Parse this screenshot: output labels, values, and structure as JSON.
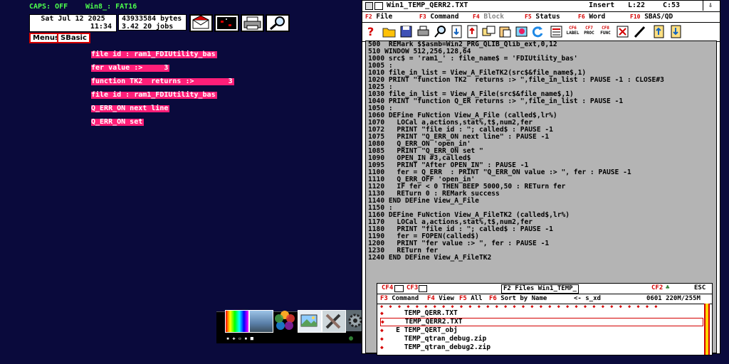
{
  "status": {
    "caps": "CAPS: OFF",
    "win": "Win8_: FAT16",
    "date": "Sat Jul 12 2025",
    "time": "11:34",
    "bytes": "43933584 bytes",
    "jobs": "3.42   20 jobs"
  },
  "buttons": {
    "menus": "Menus",
    "sbasic": "SBasic"
  },
  "output_lines": [
    "file id : ram1_FDIUtility_bas",
    "fer value :>     3",
    "function TK2  returns :>        3",
    "file id : ram1_FDIUtility_bas",
    "Q_ERR_ON next line",
    "Q_ERR_ON set"
  ],
  "editor": {
    "title": "Win1_TEMP_QERR2.TXT",
    "mode": "Insert",
    "line": "L:22",
    "col": "C:53",
    "menu": [
      {
        "key": "F2",
        "label": "File"
      },
      {
        "key": "F3",
        "label": "Command"
      },
      {
        "key": "F4",
        "label": "Block"
      },
      {
        "key": "F5",
        "label": "Status"
      },
      {
        "key": "F6",
        "label": "Word"
      },
      {
        "key": "F10",
        "label": "SBAS/QD"
      }
    ],
    "code": [
      "500  REMark $$asmb=Win2_PRG_QLIB_Qlib_ext,0,12",
      "510 WINDOW 512,256,128,64",
      "1000 src$ = 'ram1_' : file_name$ = 'FDIUtility_bas'",
      "1005 :",
      "1010 file_in_list = View_A_FileTK2(src$&file_name$,1)",
      "1020 PRINT \"function TK2  returns :> \",file_in_list : PAUSE -1 : CLOSE#3",
      "1025 :",
      "1030 file_in_list = View_A_File(src$&file_name$,1)",
      "1040 PRINT \"function Q_ER returns :> \",file_in_list : PAUSE -1",
      "1050 :",
      "1060 DEFine FuNction View_A_File (called$,lr%)",
      "1070   LOCal a,actions,stat%,t$,num2,fer",
      "1072   PRINT \"file id : \"; called$ : PAUSE -1",
      "1075   PRINT \"Q_ERR_ON next line\" : PAUSE -1",
      "1080   Q_ERR_ON 'open_in'",
      "1085   PRINT \"Q_ERR_ON set \"",
      "1090   OPEN_IN #3,called$",
      "1095   PRINT \"After OPEN_IN\" : PAUSE -1",
      "1100   fer = Q_ERR  : PRINT \"Q_ERR_ON value :> \", fer : PAUSE -1",
      "1110   Q_ERR_OFF 'open_in'",
      "1120   IF fer < 0 THEN BEEP 5000,50 : RETurn fer",
      "1130   RETurn 0 : REMark success",
      "1140 END DEFine View_A_File",
      "1150 :",
      "1160 DEFine FuNction View_A_FileTK2 (called$,lr%)",
      "1170   LOCal a,actions,stat%,t$,num2,fer",
      "1180   PRINT \"file id : \"; called$ : PAUSE -1",
      "1190   fer = FOPEN(called$)",
      "1200   PRINT \"fer value :> \", fer : PAUSE -1",
      "1230   RETurn fer",
      "1240 END DEFine View_A_FileTK2"
    ]
  },
  "files": {
    "title": "F2 Files Win1_TEMP_",
    "esc": "ESC",
    "count": "0601  220M/255M",
    "menu": {
      "command": "Command",
      "view": "View",
      "all": "All",
      "sort": "Sort by Name",
      "nav": "<-  s̲xd"
    },
    "items": [
      {
        "prefix": " ",
        "name": "TEMP_QERR.TXT"
      },
      {
        "prefix": " ",
        "name": "TEMP_QERR2.TXT"
      },
      {
        "prefix": "E",
        "name": "TEMP_QERT_obj"
      },
      {
        "prefix": " ",
        "name": "TEMP_qtran_debug.zip"
      },
      {
        "prefix": " ",
        "name": "TEMP_qtran_debug2.zip"
      }
    ]
  },
  "colors": {
    "background": "#0a0a3c",
    "accent_red": "#d40000",
    "highlight_magenta": "#ff1e78",
    "status_green": "#4dff4d"
  }
}
